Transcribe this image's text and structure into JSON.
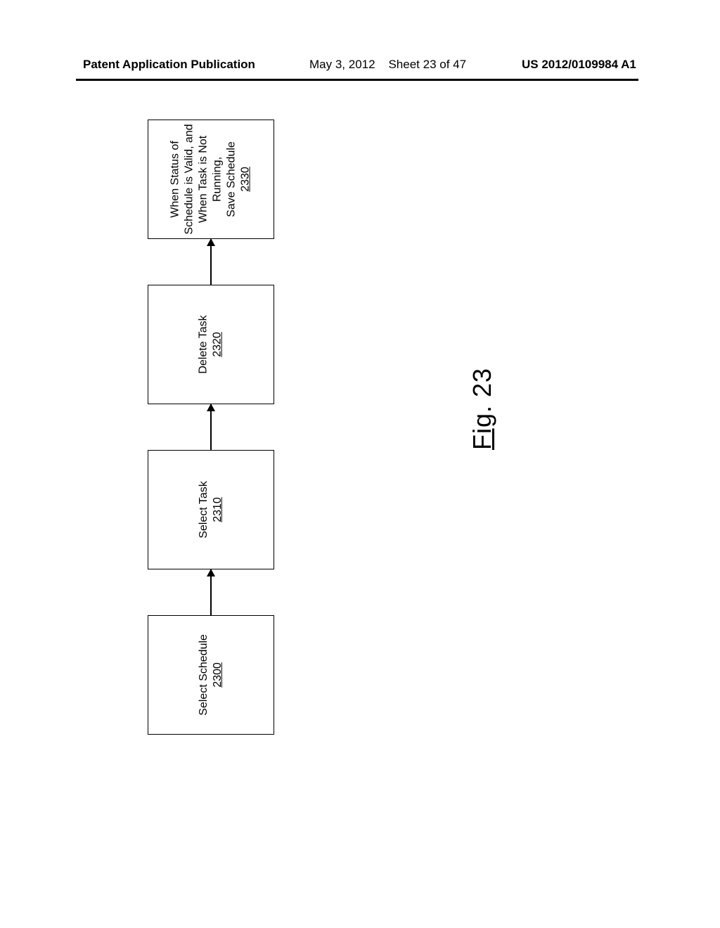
{
  "header": {
    "left": "Patent Application Publication",
    "date": "May 3, 2012",
    "sheet": "Sheet 23 of 47",
    "right": "US 2012/0109984 A1"
  },
  "boxes": {
    "b0": {
      "l1": "Select Schedule",
      "ref": "2300"
    },
    "b1": {
      "l1": "Select Task",
      "ref": "2310"
    },
    "b2": {
      "l1": "Delete Task",
      "ref": "2320"
    },
    "b3": {
      "l1": "When Status of",
      "l2": "Schedule is Valid, and",
      "l3": "When Task is Not",
      "l4": "Running,",
      "l5": "Save Schedule",
      "ref": "2330"
    }
  },
  "figure": {
    "prefix": "Fig",
    "num": ". 23"
  }
}
